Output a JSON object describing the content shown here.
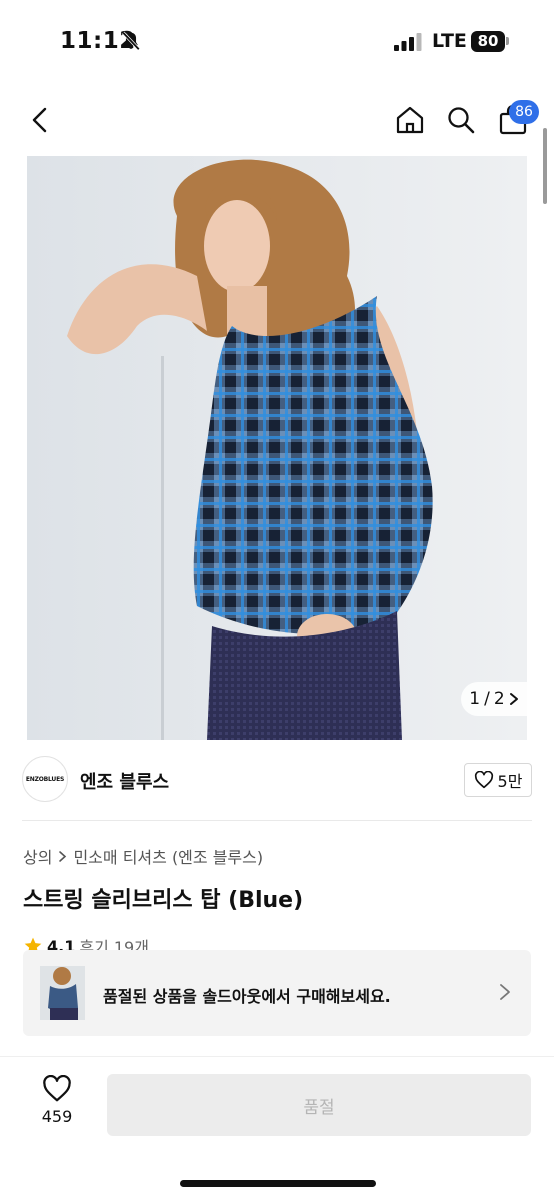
{
  "status_bar": {
    "time": "11:12",
    "network": "LTE",
    "battery": "80"
  },
  "header": {
    "cart_count": "86"
  },
  "gallery": {
    "current": "1",
    "separator": "/",
    "total": "2"
  },
  "brand": {
    "logo_text": "ENZOBLUES",
    "name": "엔조 블루스",
    "likes": "5만"
  },
  "breadcrumb": {
    "category": "상의",
    "subcategory": "민소매 티셔츠 (엔조 블루스)"
  },
  "product": {
    "title": "스트링 슬리브리스 탑 (Blue)",
    "rating": "4.1",
    "reviews": "후기 19개"
  },
  "soldout_banner": {
    "text": "품절된 상품을 솔드아웃에서 구매해보세요."
  },
  "bottom": {
    "wish_count": "459",
    "buy_label": "품절"
  },
  "colors": {
    "accent": "#2f6fe8",
    "star": "#f5b400",
    "disabled_bg": "#ececec",
    "disabled_text": "#b5b5b5"
  }
}
